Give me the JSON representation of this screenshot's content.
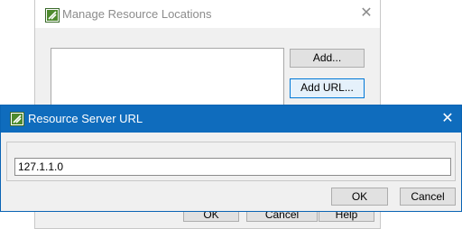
{
  "background_dialog": {
    "title": "Manage Resource Locations",
    "add_label": "Add...",
    "add_url_label": "Add URL...",
    "ok_label": "OK",
    "cancel_label": "Cancel",
    "help_label": "Help"
  },
  "url_dialog": {
    "title": "Resource Server URL",
    "url_value": "127.1.1.0",
    "ok_label": "OK",
    "cancel_label": "Cancel"
  },
  "icons": {
    "app": "app-logo-icon",
    "close": "close-icon"
  },
  "colors": {
    "titlebar_active": "#0f6cbd",
    "focus_border": "#0078d7"
  }
}
